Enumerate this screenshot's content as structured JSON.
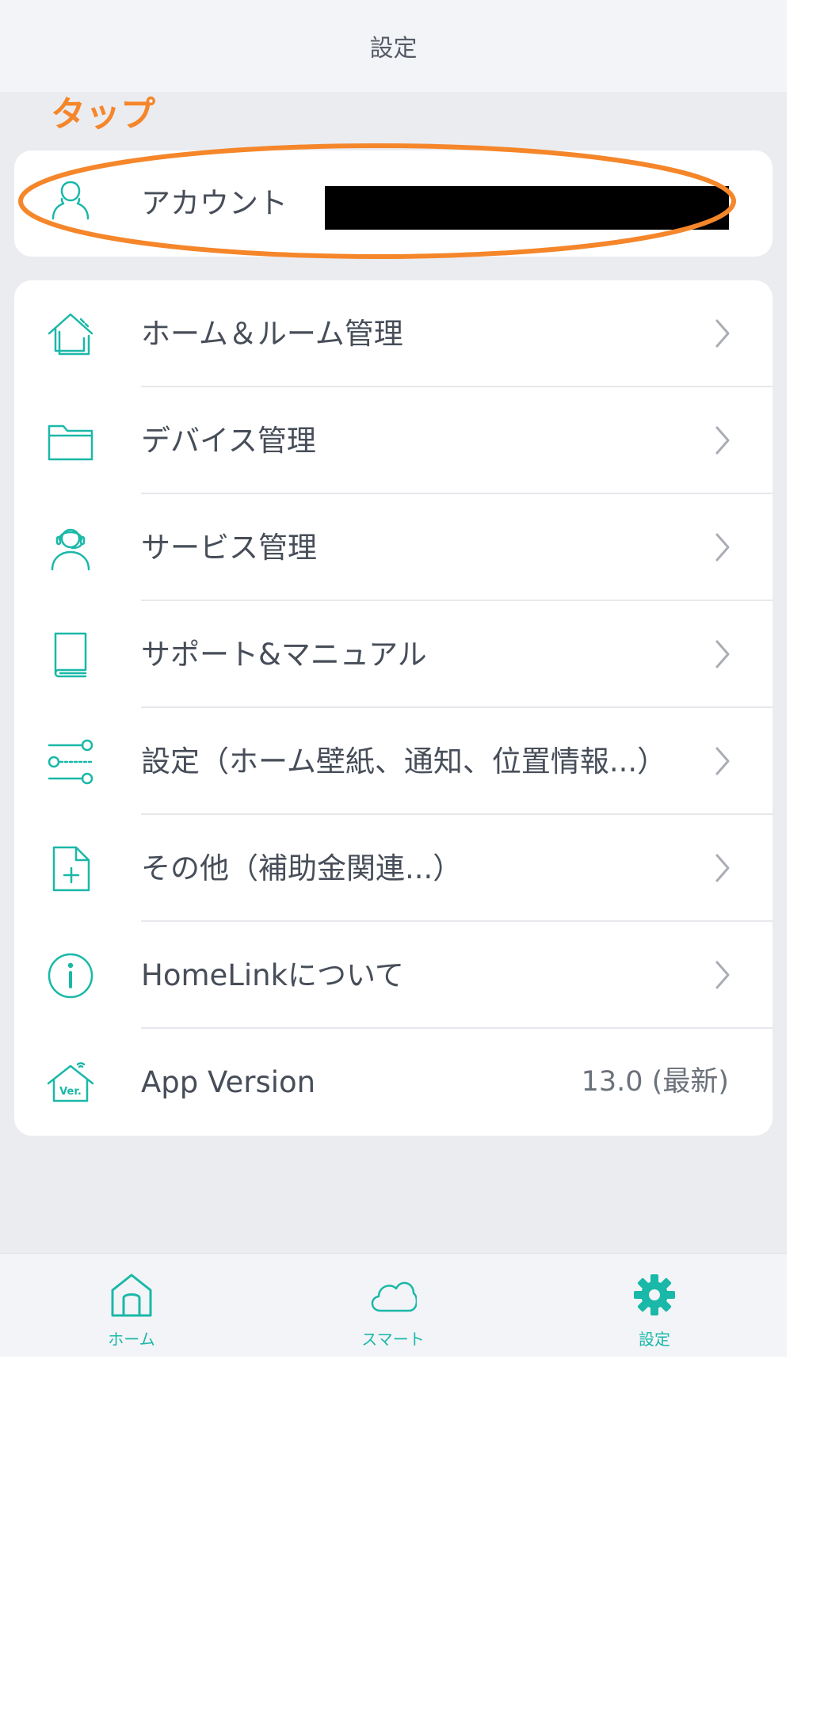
{
  "header": {
    "title": "設定"
  },
  "annotation": {
    "text": "タップ",
    "color": "#f5862a"
  },
  "account": {
    "label": "アカウント",
    "icon": "person-icon"
  },
  "menu": {
    "items": [
      {
        "label": "ホーム＆ルーム管理",
        "icon": "home-icon"
      },
      {
        "label": "デバイス管理",
        "icon": "folder-icon"
      },
      {
        "label": "サービス管理",
        "icon": "headset-person-icon"
      },
      {
        "label": "サポート&マニュアル",
        "icon": "book-icon"
      },
      {
        "label": "設定（ホーム壁紙、通知、位置情報...）",
        "icon": "sliders-icon"
      },
      {
        "label": "その他（補助金関連...）",
        "icon": "file-plus-icon"
      },
      {
        "label": "HomeLinkについて",
        "icon": "info-icon"
      }
    ],
    "version": {
      "label": "App Version",
      "value": "13.0 (最新)",
      "icon": "version-house-icon",
      "icon_text": "Ver."
    }
  },
  "tabbar": {
    "tabs": [
      {
        "label": "ホーム",
        "icon": "home-outline-icon"
      },
      {
        "label": "スマート",
        "icon": "cloud-icon"
      },
      {
        "label": "設定",
        "icon": "gear-icon",
        "active": true
      }
    ]
  },
  "colors": {
    "accent": "#1ab8a8",
    "annotation": "#f5862a",
    "background": "#ebecf0"
  }
}
